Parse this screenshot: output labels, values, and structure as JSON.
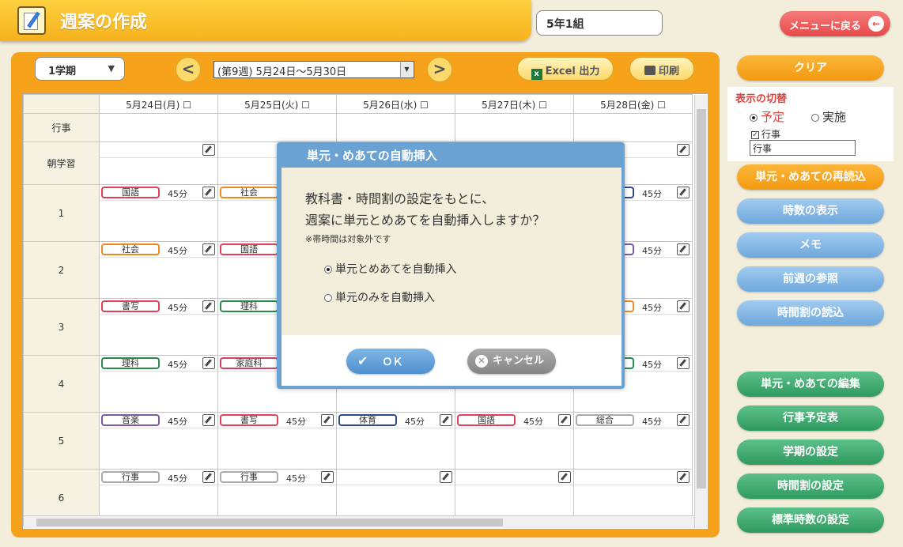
{
  "header": {
    "title": "週案の作成",
    "class_name": "5年1組",
    "back_label": "メニューに戻る",
    "back_arrow": "←"
  },
  "toolbar": {
    "term": "1学期",
    "prev": "<",
    "week": "(第9週) 5月24日～5月30日",
    "next": ">",
    "excel": "Excel 出力",
    "print": "印刷"
  },
  "grid": {
    "days": [
      "5月24日(月) ☐",
      "5月25日(火) ☐",
      "5月26日(水) ☐",
      "5月27日(木) ☐",
      "5月28日(金) ☐"
    ],
    "rows": [
      "行事",
      "朝学習",
      "1",
      "2",
      "3",
      "4",
      "5",
      "6"
    ],
    "lessons": {
      "p1": [
        [
          "国語",
          "45分",
          "red"
        ],
        [
          "社会",
          "",
          "orange"
        ],
        null,
        null,
        [
          "",
          "45分",
          "blue"
        ]
      ],
      "p2": [
        [
          "社会",
          "45分",
          "orange"
        ],
        [
          "国語",
          "",
          "red"
        ],
        null,
        null,
        [
          "",
          "45分",
          "purple"
        ]
      ],
      "p3": [
        [
          "書写",
          "45分",
          "red"
        ],
        [
          "理科",
          "",
          "green"
        ],
        null,
        null,
        [
          "",
          "45分",
          "orange"
        ]
      ],
      "p4": [
        [
          "理科",
          "45分",
          "green"
        ],
        [
          "家庭科",
          "",
          "pink"
        ],
        null,
        null,
        [
          "",
          "45分",
          "green"
        ]
      ],
      "p5": [
        [
          "音楽",
          "45分",
          "purple"
        ],
        [
          "書写",
          "45分",
          "red"
        ],
        [
          "体育",
          "45分",
          "blue"
        ],
        [
          "国語",
          "45分",
          "red"
        ],
        [
          "総合",
          "45分",
          "gray"
        ]
      ],
      "p6": [
        [
          "行事",
          "45分",
          "gray"
        ],
        [
          "行事",
          "45分",
          "gray"
        ],
        null,
        null,
        null
      ]
    }
  },
  "sidebar": {
    "clear": "クリア",
    "toggle_title": "表示の切替",
    "opt_plan": "予定",
    "opt_done": "実施",
    "events_check": "行事",
    "events_value": "行事",
    "buttons": {
      "reload": "単元・めあての再読込",
      "hours": "時数の表示",
      "memo": "メモ",
      "prev_week": "前週の参照",
      "load_timetable": "時間割の読込",
      "edit_units": "単元・めあての編集",
      "events_plan": "行事予定表",
      "term_settings": "学期の設定",
      "timetable_settings": "時間割の設定",
      "standard_hours": "標準時数の設定"
    }
  },
  "dialog": {
    "title": "単元・めあての自動挿入",
    "line1": "教科書・時間割の設定をもとに、",
    "line2": "週案に単元とめあてを自動挿入しますか？",
    "note": "※帯時間は対象外です",
    "opt1": "単元とめあてを自動挿入",
    "opt2": "単元のみを自動挿入",
    "ok": "ＯＫ",
    "cancel": "キャンセル"
  },
  "colors": {
    "red": "#e0405a",
    "orange": "#f08a20",
    "green": "#2a8a4a",
    "purple": "#7a5aa8",
    "blue": "#2a4a8a",
    "gray": "#aaaaaa",
    "pink": "#d04060"
  }
}
